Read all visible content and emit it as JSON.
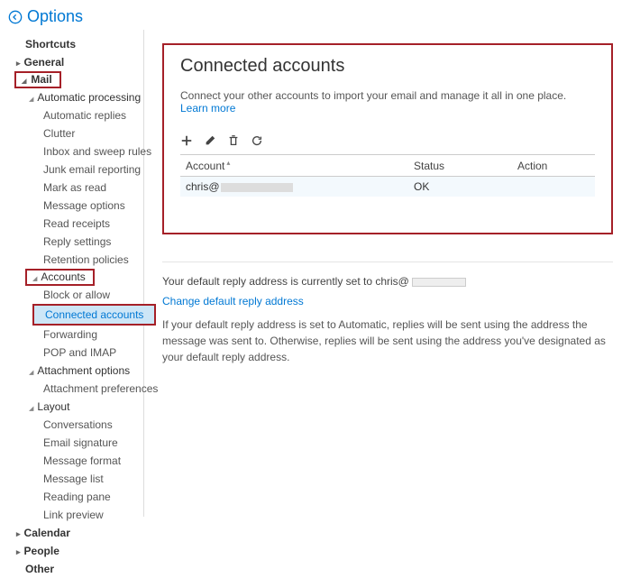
{
  "header": {
    "title": "Options"
  },
  "sidebar": {
    "shortcuts": "Shortcuts",
    "general": "General",
    "mail": "Mail",
    "mailChildren": {
      "autoProcessing": "Automatic processing",
      "autoReplies": "Automatic replies",
      "clutter": "Clutter",
      "inboxSweep": "Inbox and sweep rules",
      "junkReport": "Junk email reporting",
      "markRead": "Mark as read",
      "msgOptions": "Message options",
      "readReceipts": "Read receipts",
      "replySettings": "Reply settings",
      "retention": "Retention policies",
      "accounts": "Accounts",
      "blockAllow": "Block or allow",
      "connected": "Connected accounts",
      "forwarding": "Forwarding",
      "popImap": "POP and IMAP",
      "attachOpt": "Attachment options",
      "attachPref": "Attachment preferences",
      "layout": "Layout",
      "conversations": "Conversations",
      "emailSig": "Email signature",
      "msgFormat": "Message format",
      "msgList": "Message list",
      "readingPane": "Reading pane",
      "linkPreview": "Link preview"
    },
    "calendar": "Calendar",
    "people": "People",
    "other": "Other"
  },
  "content": {
    "title": "Connected accounts",
    "desc": "Connect your other accounts to import your email and manage it all in one place.",
    "learnMore": "Learn more",
    "table": {
      "colAccount": "Account",
      "colStatus": "Status",
      "colAction": "Action",
      "row": {
        "account": "chris@",
        "status": "OK"
      }
    },
    "replyNote": "Your default reply address is currently set to chris@",
    "changeLink": "Change default reply address",
    "helpText": "If your default reply address is set to Automatic, replies will be sent using the address the message was sent to. Otherwise, replies will be sent using the address you've designated as your default reply address."
  }
}
